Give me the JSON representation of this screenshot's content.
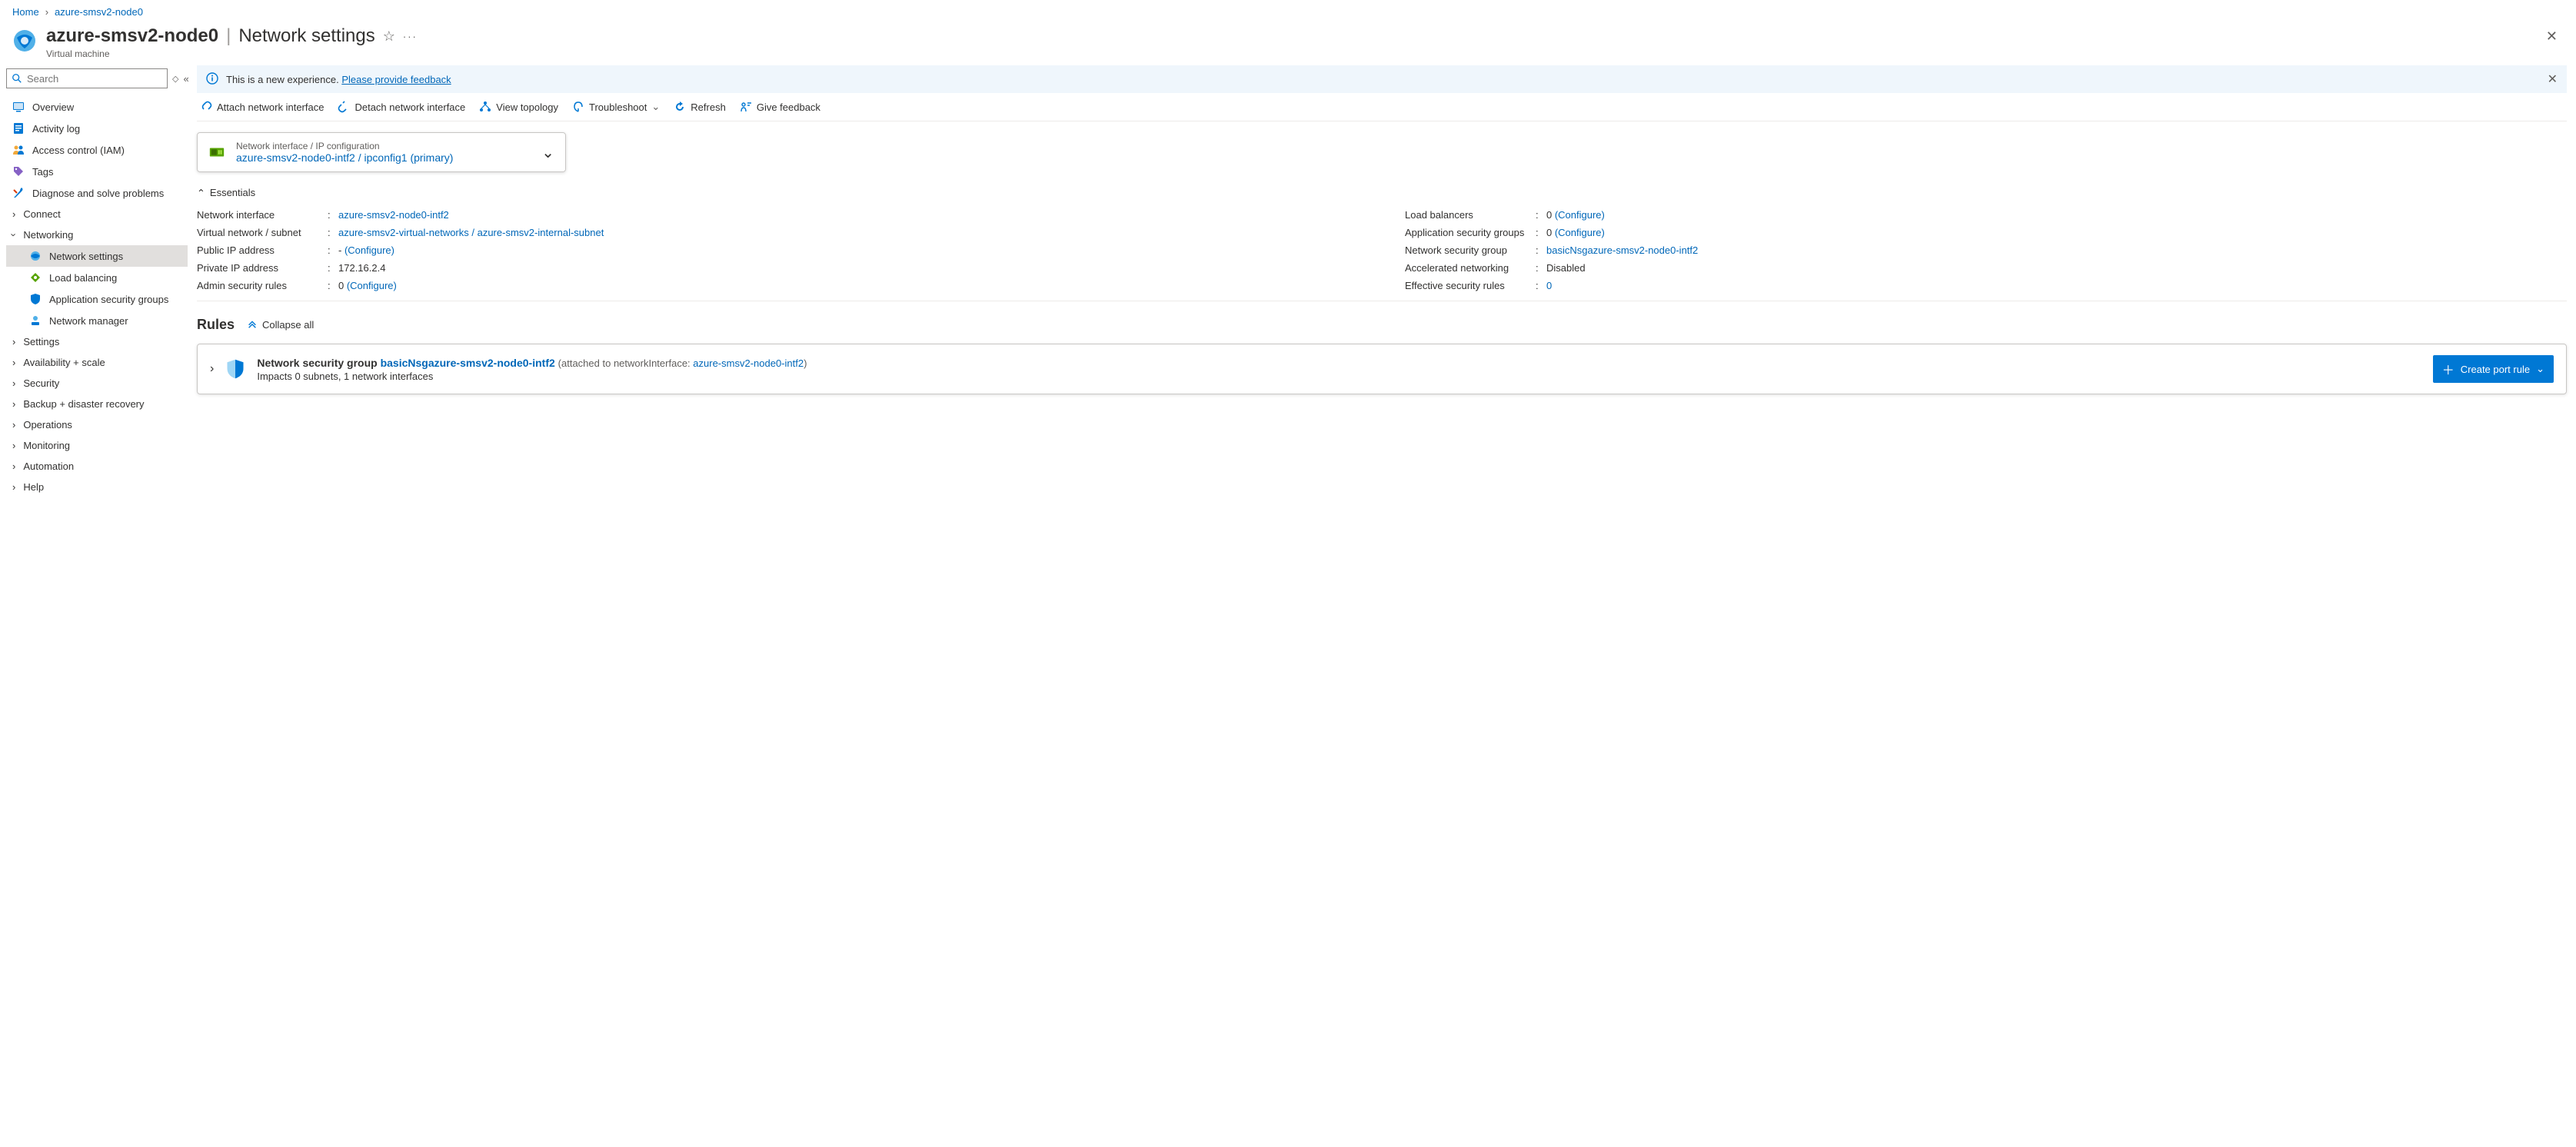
{
  "breadcrumb": {
    "home": "Home",
    "resource": "azure-smsv2-node0"
  },
  "header": {
    "resource_name": "azure-smsv2-node0",
    "page_name": "Network settings",
    "subtitle": "Virtual machine"
  },
  "search": {
    "placeholder": "Search"
  },
  "sidebar": {
    "overview": "Overview",
    "activity_log": "Activity log",
    "access_control": "Access control (IAM)",
    "tags": "Tags",
    "diagnose": "Diagnose and solve problems",
    "connect": "Connect",
    "networking": "Networking",
    "network_settings": "Network settings",
    "load_balancing": "Load balancing",
    "asg": "Application security groups",
    "network_manager": "Network manager",
    "settings": "Settings",
    "availability": "Availability + scale",
    "security": "Security",
    "backup": "Backup + disaster recovery",
    "operations": "Operations",
    "monitoring": "Monitoring",
    "automation": "Automation",
    "help": "Help"
  },
  "banner": {
    "text": "This is a new experience.",
    "link": "Please provide feedback"
  },
  "toolbar": {
    "attach": "Attach network interface",
    "detach": "Detach network interface",
    "topology": "View topology",
    "troubleshoot": "Troubleshoot",
    "refresh": "Refresh",
    "feedback": "Give feedback"
  },
  "nic_card": {
    "label": "Network interface / IP configuration",
    "value": "azure-smsv2-node0-intf2 / ipconfig1 (primary)"
  },
  "essentials": {
    "title": "Essentials",
    "network_interface": {
      "label": "Network interface",
      "value": "azure-smsv2-node0-intf2"
    },
    "vnet_subnet": {
      "label": "Virtual network / subnet",
      "value": "azure-smsv2-virtual-networks / azure-smsv2-internal-subnet"
    },
    "public_ip": {
      "label": "Public IP address",
      "prefix": "- ",
      "configure": "(Configure)"
    },
    "private_ip": {
      "label": "Private IP address",
      "value": "172.16.2.4"
    },
    "admin_rules": {
      "label": "Admin security rules",
      "prefix": "0 ",
      "configure": "(Configure)"
    },
    "load_balancers": {
      "label": "Load balancers",
      "prefix": "0 ",
      "configure": "(Configure)"
    },
    "asg": {
      "label": "Application security groups",
      "prefix": "0 ",
      "configure": "(Configure)"
    },
    "nsg": {
      "label": "Network security group",
      "value": "basicNsgazure-smsv2-node0-intf2"
    },
    "accel_net": {
      "label": "Accelerated networking",
      "value": "Disabled"
    },
    "eff_rules": {
      "label": "Effective security rules",
      "value": "0"
    }
  },
  "rules": {
    "title": "Rules",
    "collapse": "Collapse all",
    "nsg_prefix": "Network security group",
    "nsg_name": "basicNsgazure-smsv2-node0-intf2",
    "attached_prefix": "(attached to networkInterface:",
    "attached_link": "azure-smsv2-node0-intf2",
    "attached_suffix": ")",
    "impacts": "Impacts 0 subnets, 1 network interfaces",
    "create_button": "Create port rule"
  }
}
